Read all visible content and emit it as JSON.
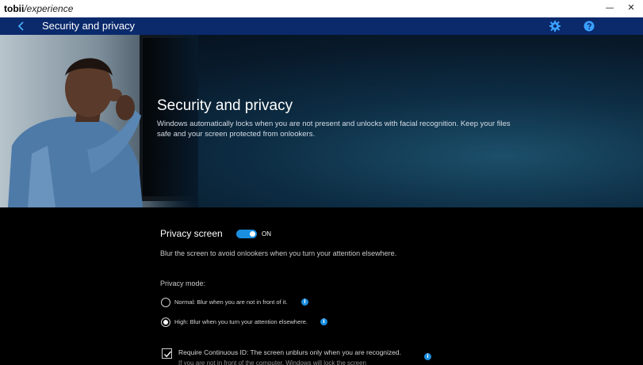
{
  "window": {
    "brand_bold": "tobii",
    "brand_suffix": "/experience",
    "controls": {
      "minimize": "—",
      "close": "✕"
    }
  },
  "header": {
    "back_icon": "chevron-left-icon",
    "title": "Security and privacy",
    "icons": [
      "gear-icon",
      "help-icon"
    ],
    "accent": "#1a8fe0",
    "background": "#0a2a6c"
  },
  "hero": {
    "title": "Security and privacy",
    "description": "Windows automatically locks when you are not present and unlocks with facial recognition. Keep your files safe and your screen protected from onlookers."
  },
  "privacy_screen": {
    "title": "Privacy screen",
    "toggle_on": true,
    "toggle_state": "ON",
    "description": "Blur the screen to avoid onlookers when you turn your attention elsewhere.",
    "mode_label": "Privacy mode:",
    "options": [
      {
        "label": "Normal: Blur when you are not in front of it.",
        "selected": false
      },
      {
        "label": "High: Blur when you turn your attention elsewhere.",
        "selected": true
      }
    ],
    "continuous_id": {
      "checked": true,
      "label": "Require Continuous ID: The screen unblurs only when you are recognized.",
      "sub": "If you are not in front of the computer, Windows will lock the screen"
    }
  }
}
